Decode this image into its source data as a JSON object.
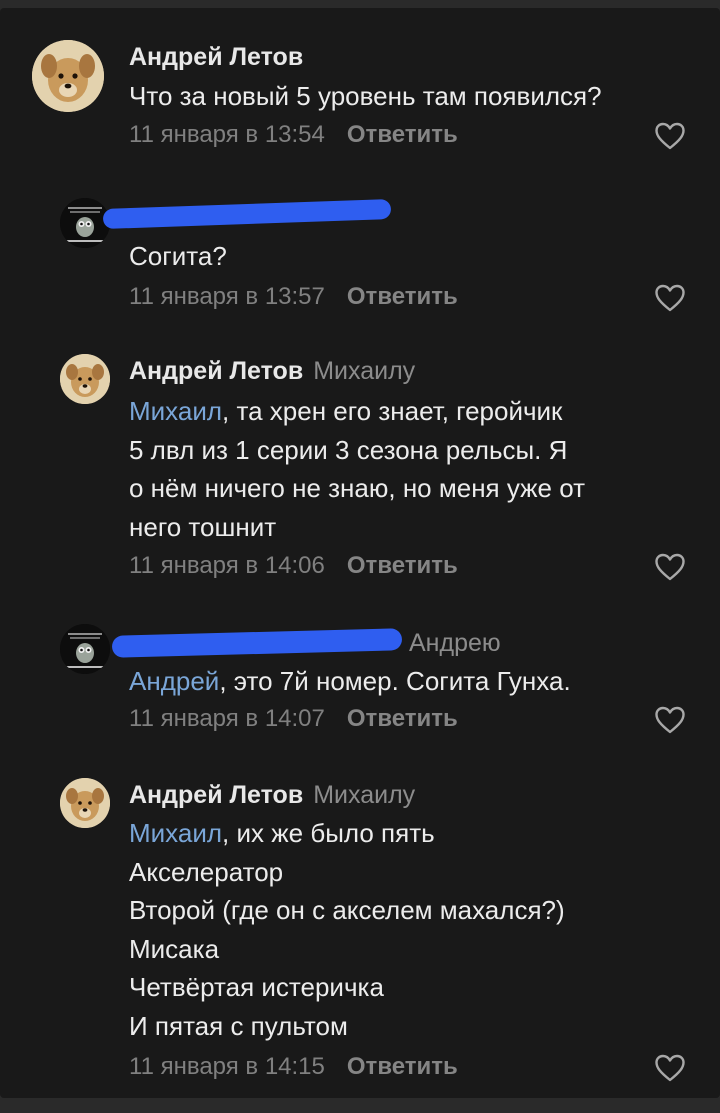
{
  "comments": [
    {
      "author": "Андрей Летов",
      "reply_to": "",
      "mention": "",
      "lines": [
        "Что за новый 5 уровень там появился?"
      ],
      "date": "11 января в 13:54",
      "reply_label": "Ответить"
    },
    {
      "author": "",
      "reply_to": "",
      "mention": "",
      "lines": [
        "Согита?"
      ],
      "date": "11 января в 13:57",
      "reply_label": "Ответить"
    },
    {
      "author": "Андрей Летов",
      "reply_to": "Михаилу",
      "mention": "Михаил",
      "lines": [
        ", та хрен его знает, геройчик",
        "5 лвл из 1 серии 3 сезона рельсы. Я",
        "о нём ничего не знаю, но меня уже от",
        "него тошнит"
      ],
      "date": "11 января в 14:06",
      "reply_label": "Ответить"
    },
    {
      "author": "",
      "reply_to": "Андрею",
      "mention": "Андрей",
      "lines": [
        ", это 7й номер. Согита Гунха."
      ],
      "date": "11 января в 14:07",
      "reply_label": "Ответить"
    },
    {
      "author": "Андрей Летов",
      "reply_to": "Михаилу",
      "mention": "Михаил",
      "lines": [
        ", их же было пять",
        "Акселератор",
        "Второй (где он с акселем махался?)",
        "Мисака",
        "Четвёртая истеричка",
        "И пятая с пультом"
      ],
      "date": "11 января в 14:15",
      "reply_label": "Ответить"
    }
  ],
  "icons": {
    "like": "heart-outline-icon",
    "avatar_dog": "dog-avatar",
    "avatar_owl": "owl-avatar"
  },
  "colors": {
    "background": "#191919",
    "mention": "#7aa6d8",
    "redaction": "#2f5ef0"
  }
}
